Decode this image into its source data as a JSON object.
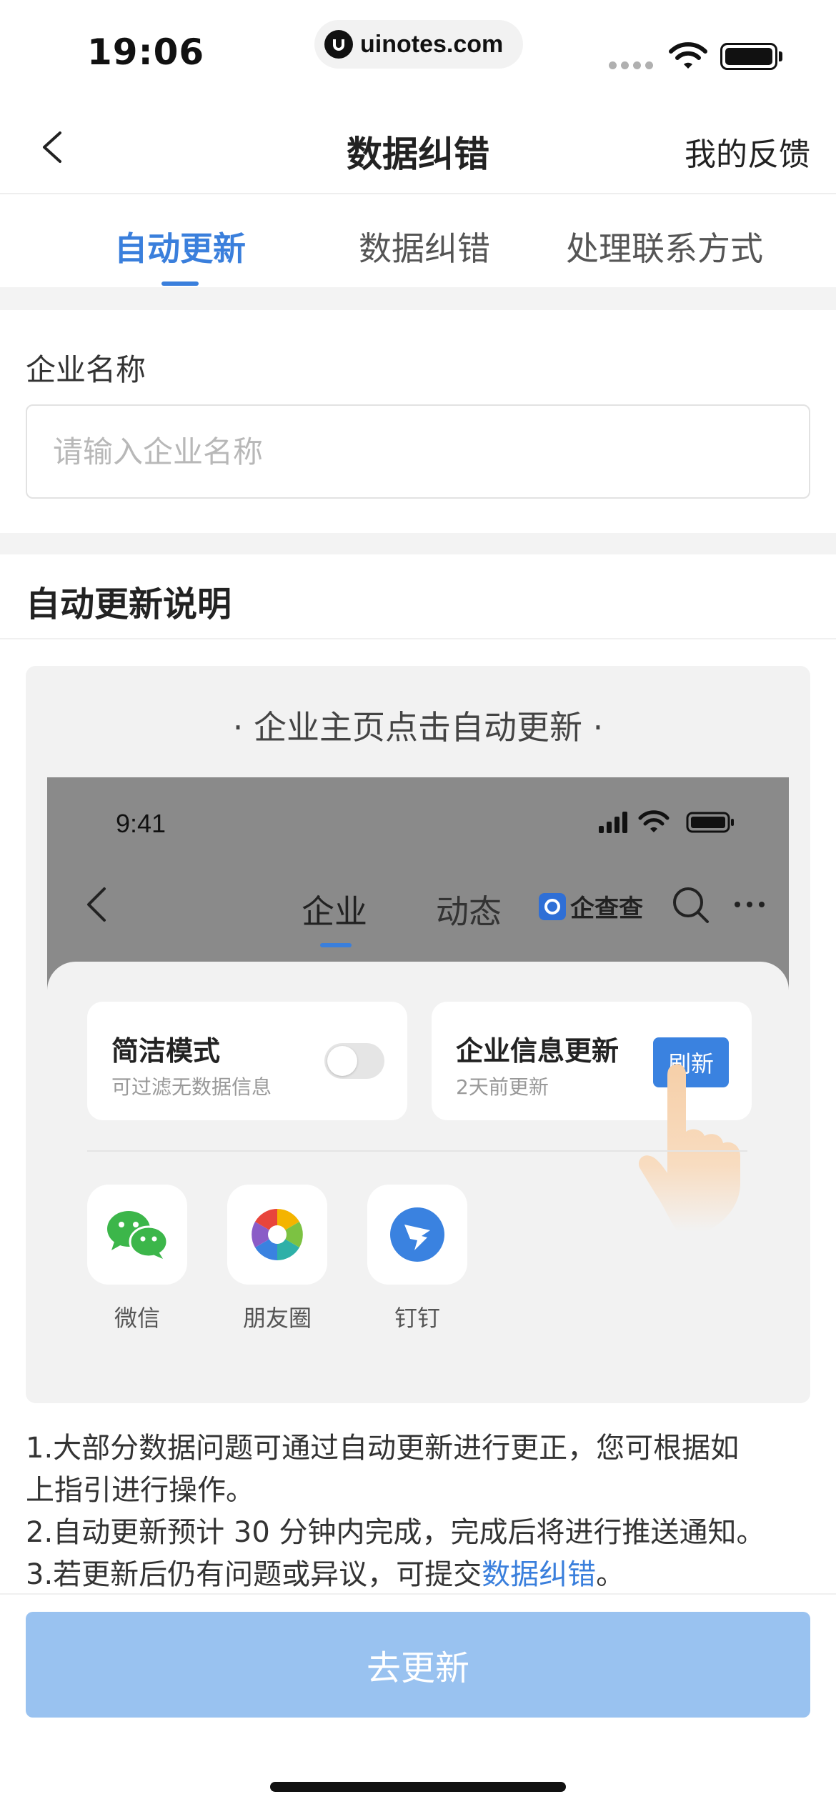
{
  "status_bar": {
    "time": "19:06",
    "url": "uinotes.com"
  },
  "nav": {
    "title": "数据纠错",
    "right_action": "我的反馈",
    "back_icon": "chevron-left-icon"
  },
  "tabs": [
    {
      "label": "自动更新",
      "active": true
    },
    {
      "label": "数据纠错",
      "active": false
    },
    {
      "label": "处理联系方式",
      "active": false
    }
  ],
  "form": {
    "company_label": "企业名称",
    "company_placeholder": "请输入企业名称",
    "company_value": ""
  },
  "guide": {
    "section_title": "自动更新说明",
    "card_title": "· 企业主页点击自动更新 ·",
    "mock": {
      "time": "9:41",
      "tab_company": "企业",
      "tab_dynamic": "动态",
      "brand": "企查查",
      "option_simple_title": "简洁模式",
      "option_simple_sub": "可过滤无数据信息",
      "option_update_title": "企业信息更新",
      "option_update_sub": "2天前更新",
      "refresh_label": "刷新",
      "share": [
        {
          "label": "微信",
          "icon": "wechat-icon"
        },
        {
          "label": "朋友圈",
          "icon": "moments-icon"
        },
        {
          "label": "钉钉",
          "icon": "dingtalk-icon"
        }
      ]
    }
  },
  "notes": {
    "line1": "1.大部分数据问题可通过自动更新进行更正，您可根据如",
    "line2": "上指引进行操作。",
    "line3": "2.自动更新预计 30 分钟内完成，完成后将进行推送通知。",
    "line4_prefix": "3.若更新后仍有问题或异议，可提交",
    "line4_link": "数据纠错",
    "line4_suffix": "。"
  },
  "action": {
    "submit_label": "去更新"
  },
  "colors": {
    "accent": "#3a7fdc",
    "button_disabled": "#99c2f0",
    "band": "#f3f3f3"
  }
}
